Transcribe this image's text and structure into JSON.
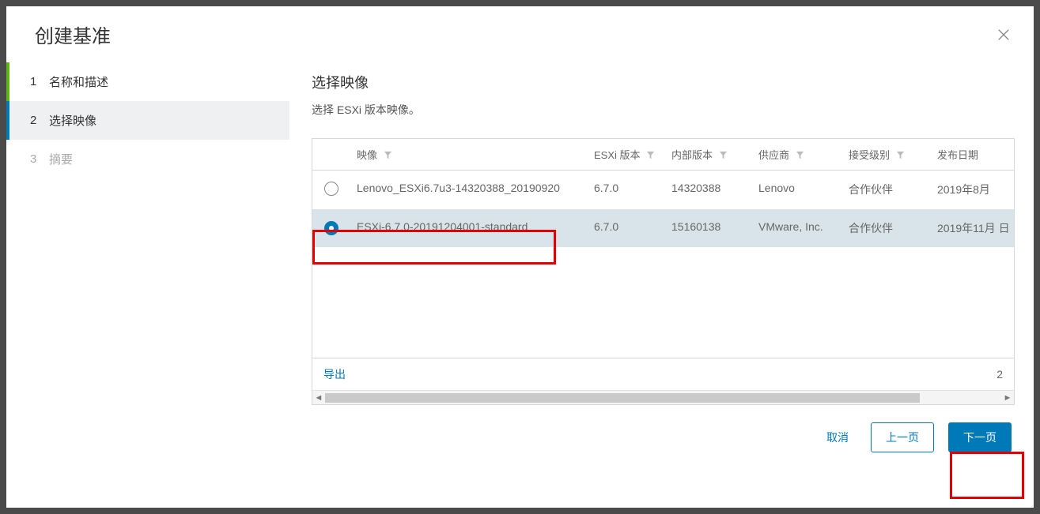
{
  "modal": {
    "title": "创建基准",
    "close_icon": "close"
  },
  "steps": [
    {
      "num": "1",
      "label": "名称和描述",
      "state": "completed"
    },
    {
      "num": "2",
      "label": "选择映像",
      "state": "active"
    },
    {
      "num": "3",
      "label": "摘要",
      "state": "disabled"
    }
  ],
  "section": {
    "title": "选择映像",
    "desc": "选择 ESXi 版本映像。"
  },
  "table": {
    "headers": {
      "image": "映像",
      "esxi_version": "ESXi 版本",
      "build": "内部版本",
      "vendor": "供应商",
      "acceptance": "接受级别",
      "release_date": "发布日期"
    },
    "rows": [
      {
        "selected": false,
        "image": "Lenovo_ESXi6.7u3-14320388_20190920",
        "esxi_version": "6.7.0",
        "build": "14320388",
        "vendor": "Lenovo",
        "acceptance": "合作伙伴",
        "release_date": "2019年8月"
      },
      {
        "selected": true,
        "image": "ESXi-6.7.0-20191204001-standard",
        "esxi_version": "6.7.0",
        "build": "15160138",
        "vendor": "VMware, Inc.",
        "acceptance": "合作伙伴",
        "release_date": "2019年11月 日"
      }
    ],
    "export_label": "导出",
    "count": "2"
  },
  "footer": {
    "cancel": "取消",
    "prev": "上一页",
    "next": "下一页"
  }
}
